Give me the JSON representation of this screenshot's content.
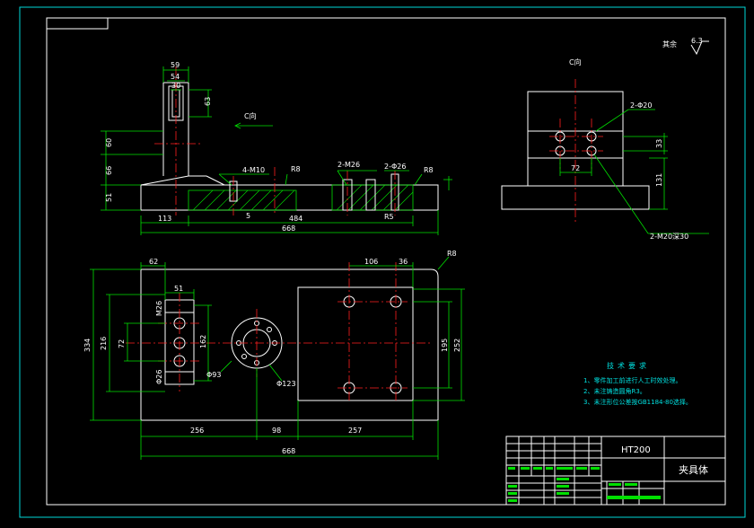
{
  "views": {
    "view_c": {
      "label": "C向"
    },
    "arrow_label": "C向"
  },
  "front_view": {
    "dims": {
      "top_59": "59",
      "top_54": "54",
      "top_30": "30",
      "top_63": "63",
      "left_60": "60",
      "left_66": "66",
      "left_51": "51",
      "thread_m10": "4-M10",
      "radius_r8_a": "R8",
      "thread_m26": "2-M26",
      "hole_26": "2-Φ26",
      "radius_r8_b": "R8",
      "radius_r5": "R5",
      "dim_r5_small": "5",
      "bot_113": "113",
      "bot_484": "484",
      "bot_668": "668"
    }
  },
  "side_view": {
    "dims": {
      "hole_20": "2-Φ20",
      "dim_33": "33",
      "dim_72": "72",
      "dim_131": "131",
      "thread_m20": "2-M20深30"
    }
  },
  "plan_view": {
    "dims": {
      "top_62": "62",
      "top_106": "106",
      "top_36": "36",
      "radius_r8": "R8",
      "dim_51": "51",
      "thread_m26": "M26",
      "left_334": "334",
      "left_216": "216",
      "left_72": "72",
      "dim_162": "162",
      "dim_26": "Φ26",
      "dia_93": "Φ93",
      "dia_123": "Φ123",
      "right_195": "195",
      "right_252": "252",
      "bot_256": "256",
      "bot_98": "98",
      "bot_257": "257",
      "bot_668": "668"
    }
  },
  "surface": {
    "label": "其余",
    "value": "6.3"
  },
  "tech_requirements": {
    "title": "技术要求",
    "items": [
      "1、零件加工前进行人工时效处理。",
      "2、未注铸造圆角R3。",
      "3、未注形位公差按GB1184-80选择。"
    ]
  },
  "title_block": {
    "material": "HT200",
    "part_name": "夹具体"
  }
}
